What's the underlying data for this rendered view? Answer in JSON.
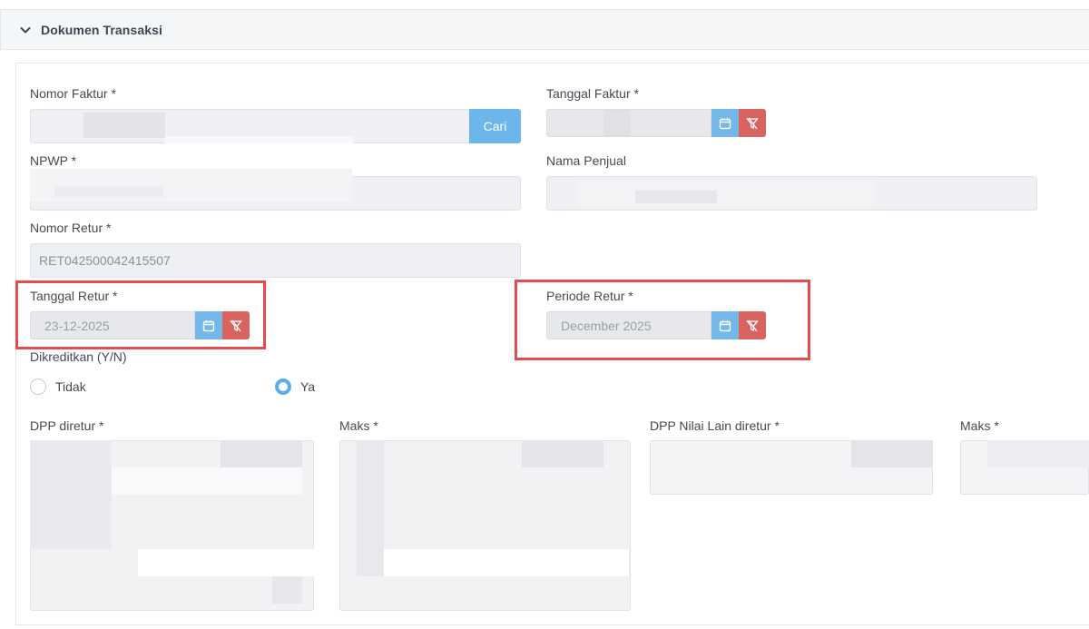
{
  "section": {
    "title": "Dokumen Transaksi",
    "icon": "chevron-down-icon"
  },
  "nomor_faktur": {
    "label": "Nomor Faktur *",
    "value": "",
    "button": "Cari"
  },
  "tanggal_faktur": {
    "label": "Tanggal Faktur *",
    "value": ""
  },
  "npwp": {
    "label": "NPWP *",
    "value": ""
  },
  "nama_penjual": {
    "label": "Nama Penjual",
    "value": ""
  },
  "nomor_retur": {
    "label": "Nomor Retur *",
    "value": "RET042500042415507"
  },
  "tanggal_retur": {
    "label": "Tanggal Retur *",
    "value": "23-12-2025"
  },
  "periode_retur": {
    "label": "Periode Retur *",
    "value": "December 2025"
  },
  "dikreditkan": {
    "label": "Dikreditkan (Y/N)",
    "options": [
      {
        "label": "Tidak",
        "selected": false
      },
      {
        "label": "Ya",
        "selected": true
      }
    ]
  },
  "dpp_diretur": {
    "label": "DPP diretur *"
  },
  "maks_1": {
    "label": "Maks *"
  },
  "dpp_nilai_lain": {
    "label": "DPP Nilai Lain diretur *"
  },
  "maks_2": {
    "label": "Maks *"
  },
  "colors": {
    "calendar_button": "#74b8ea",
    "clear_button": "#d9645f",
    "search_button": "#6cb6ec",
    "highlight": "#e84b4b",
    "radio_selected": "#5aaee8"
  }
}
